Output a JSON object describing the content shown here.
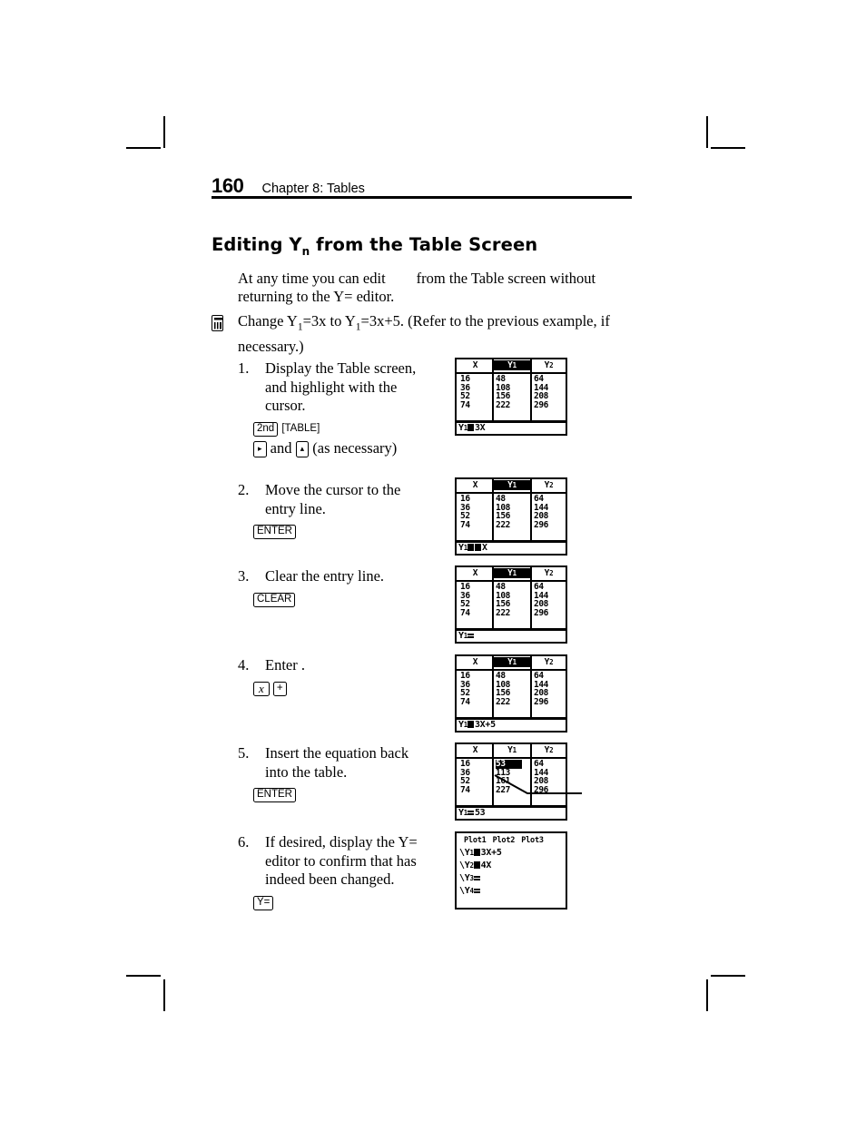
{
  "page": {
    "folio": "160",
    "running_title": "Chapter 8: Tables",
    "heading_prefix": "Editing Y",
    "heading_sub": "n",
    "heading_suffix": " from the Table Screen",
    "intro_part1": "At any time you can edit",
    "intro_part2": "from the Table screen without returning to the Y= editor."
  },
  "example": {
    "text_a": "Change Y",
    "sub_1": "1",
    "text_b": "=3x to Y",
    "sub_2": "1",
    "text_c": "=3x+5. (Refer to the previous example, if necessary.)",
    "icon": "calculator-icon"
  },
  "steps": [
    {
      "num": "1.",
      "text": "Display the Table screen, and highlight     with the cursor.",
      "keys": [
        {
          "type": "key",
          "label": "2nd"
        },
        {
          "type": "bracket",
          "label": "[TABLE]"
        },
        {
          "type": "break"
        },
        {
          "type": "arrowkey",
          "label": "▸"
        },
        {
          "type": "word",
          "label": " and "
        },
        {
          "type": "arrowkey",
          "label": "▴"
        },
        {
          "type": "word",
          "label": " (as necessary)"
        }
      ]
    },
    {
      "num": "2.",
      "text": "Move the cursor to the entry line.",
      "keys": [
        {
          "type": "key",
          "label": "ENTER"
        }
      ]
    },
    {
      "num": "3.",
      "text": "Clear the entry line.",
      "keys": [
        {
          "type": "key",
          "label": "CLEAR"
        }
      ]
    },
    {
      "num": "4.",
      "text": "Enter        .",
      "keys": [
        {
          "type": "italickey",
          "label": "x"
        },
        {
          "type": "key",
          "label": "+"
        }
      ]
    },
    {
      "num": "5.",
      "text": "Insert the equation back into the table.",
      "keys": [
        {
          "type": "key",
          "label": "ENTER"
        }
      ]
    },
    {
      "num": "6.",
      "text": "If desired, display the Y= editor to confirm that         has indeed been changed.",
      "keys": [
        {
          "type": "key",
          "label": "Y="
        }
      ]
    }
  ],
  "screens": [
    {
      "id": "screen-step-1",
      "kind": "table",
      "headers": [
        "X",
        "Y1",
        "Y2"
      ],
      "header_subs": [
        "",
        "1",
        "2"
      ],
      "highlight_header_index": 1,
      "columns": [
        [
          "16",
          "36",
          "52",
          "74"
        ],
        [
          "48",
          "108",
          "156",
          "222"
        ],
        [
          "64",
          "144",
          "208",
          "296"
        ]
      ],
      "entry_prefix": "Y",
      "entry_sub": "1",
      "entry_symbol": "equals-block",
      "entry_value": "3X",
      "cursor_block": false,
      "highlight_cell": null
    },
    {
      "id": "screen-step-2",
      "kind": "table",
      "headers": [
        "X",
        "Y1",
        "Y2"
      ],
      "header_subs": [
        "",
        "1",
        "2"
      ],
      "highlight_header_index": 1,
      "columns": [
        [
          "16",
          "36",
          "52",
          "74"
        ],
        [
          "48",
          "108",
          "156",
          "222"
        ],
        [
          "64",
          "144",
          "208",
          "296"
        ]
      ],
      "entry_prefix": "Y",
      "entry_sub": "1",
      "entry_symbol": "equals-block",
      "entry_value": "X",
      "cursor_block": true,
      "highlight_cell": null
    },
    {
      "id": "screen-step-3",
      "kind": "table",
      "headers": [
        "X",
        "Y1",
        "Y2"
      ],
      "header_subs": [
        "",
        "1",
        "2"
      ],
      "highlight_header_index": 1,
      "columns": [
        [
          "16",
          "36",
          "52",
          "74"
        ],
        [
          "48",
          "108",
          "156",
          "222"
        ],
        [
          "64",
          "144",
          "208",
          "296"
        ]
      ],
      "entry_prefix": "Y",
      "entry_sub": "1",
      "entry_symbol": "plain-equals",
      "entry_value": "",
      "cursor_block": false,
      "highlight_cell": null
    },
    {
      "id": "screen-step-4",
      "kind": "table",
      "headers": [
        "X",
        "Y1",
        "Y2"
      ],
      "header_subs": [
        "",
        "1",
        "2"
      ],
      "highlight_header_index": 1,
      "columns": [
        [
          "16",
          "36",
          "52",
          "74"
        ],
        [
          "48",
          "108",
          "156",
          "222"
        ],
        [
          "64",
          "144",
          "208",
          "296"
        ]
      ],
      "entry_prefix": "Y",
      "entry_sub": "1",
      "entry_symbol": "equals-block",
      "entry_value": "3X+5",
      "cursor_block": false,
      "highlight_cell": null
    },
    {
      "id": "screen-step-5",
      "kind": "table",
      "headers": [
        "X",
        "Y1",
        "Y2"
      ],
      "header_subs": [
        "",
        "1",
        "2"
      ],
      "highlight_header_index": -1,
      "columns": [
        [
          "16",
          "36",
          "52",
          "74"
        ],
        [
          "53",
          "113",
          "161",
          "227"
        ],
        [
          "64",
          "144",
          "208",
          "296"
        ]
      ],
      "entry_prefix": "Y",
      "entry_sub": "1",
      "entry_symbol": "plain-equals",
      "entry_value": "53",
      "cursor_block": false,
      "highlight_cell": {
        "column": 1,
        "row": 0,
        "value": "53"
      },
      "has_callout": true
    },
    {
      "id": "screen-step-6",
      "kind": "y-editor",
      "plots": [
        "Plot1",
        "Plot2",
        "Plot3"
      ],
      "lines": [
        {
          "prefix": "\\Y",
          "sub": "1",
          "symbol": "equals-block",
          "value": "3X+5"
        },
        {
          "prefix": "\\Y",
          "sub": "2",
          "symbol": "equals-block",
          "value": "4X"
        },
        {
          "prefix": "\\Y",
          "sub": "3",
          "symbol": "plain-equals",
          "value": ""
        },
        {
          "prefix": "\\Y",
          "sub": "4",
          "symbol": "plain-equals",
          "value": ""
        }
      ]
    }
  ]
}
